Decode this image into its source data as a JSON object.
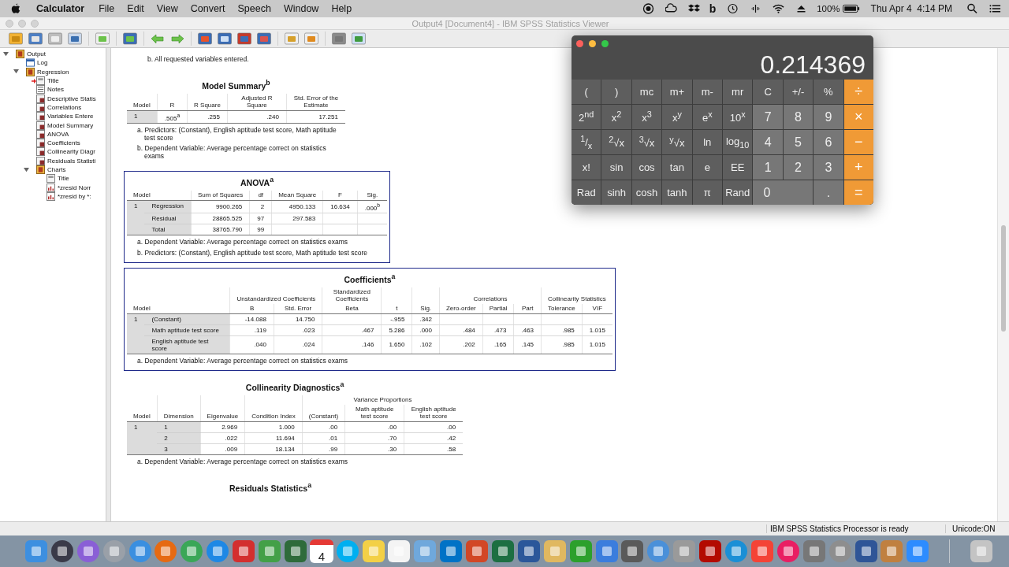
{
  "menu_bar": {
    "app": "Calculator",
    "menus": [
      "File",
      "Edit",
      "View",
      "Convert",
      "Speech",
      "Window",
      "Help"
    ],
    "status_letter": "b",
    "battery": "100%",
    "clock": "Thu Apr 4  4:14 PM"
  },
  "window": {
    "title": "Output4 [Document4] - IBM SPSS Statistics Viewer"
  },
  "navigator": [
    {
      "label": "Output",
      "kind": "book",
      "expanded": true,
      "current": false,
      "children": [
        {
          "label": "Log",
          "kind": "log",
          "current": false
        },
        {
          "label": "Regression",
          "kind": "book",
          "expanded": true,
          "current": false,
          "children": [
            {
              "label": "Title",
              "kind": "title",
              "current": true
            },
            {
              "label": "Notes",
              "kind": "notes",
              "current": false
            },
            {
              "label": "Descriptive Statis",
              "kind": "table",
              "current": false
            },
            {
              "label": "Correlations",
              "kind": "table",
              "current": false
            },
            {
              "label": "Variables Entere",
              "kind": "table",
              "current": false
            },
            {
              "label": "Model Summary",
              "kind": "table",
              "current": false
            },
            {
              "label": "ANOVA",
              "kind": "table",
              "current": false
            },
            {
              "label": "Coefficients",
              "kind": "table",
              "current": false
            },
            {
              "label": "Collinearity Diagr",
              "kind": "table",
              "current": false
            },
            {
              "label": "Residuals Statisti",
              "kind": "table",
              "current": false
            },
            {
              "label": "Charts",
              "kind": "book",
              "expanded": true,
              "current": false,
              "children": [
                {
                  "label": "Title",
                  "kind": "title",
                  "current": false
                },
                {
                  "label": "*zresid Norr",
                  "kind": "chart",
                  "current": false
                },
                {
                  "label": "*zresid by *:",
                  "kind": "chart",
                  "current": false
                }
              ]
            }
          ]
        }
      ]
    }
  ],
  "viewer": {
    "leading_note": "b. All requested variables entered.",
    "tables": [
      {
        "title": "Model Summary$^{b}$",
        "selected": false,
        "header_rows": [
          [
            {
              "text": "Model"
            },
            {
              "text": "R"
            },
            {
              "text": "R Square"
            },
            {
              "text": "Adjusted R Square"
            },
            {
              "text": "Std. Error of the Estimate"
            }
          ]
        ],
        "rows": [
          {
            "model": "1",
            "values": {
              "r": ".505$^{a}$",
              "r_square": ".255",
              "adjusted_r_square": ".240",
              "std_error": "17.251"
            }
          }
        ],
        "footnotes": [
          "a. Predictors: (Constant), English aptitude test score, Math aptitude test score",
          "b. Dependent Variable: Average percentage correct on statistics exams"
        ]
      },
      {
        "title": "ANOVA$^{a}$",
        "selected": true,
        "header_rows": [
          [
            {
              "text": "Model"
            },
            {
              "text": "Sum of Squares"
            },
            {
              "text": "df"
            },
            {
              "text": "Mean Square"
            },
            {
              "text": "F"
            },
            {
              "text": "Sig."
            }
          ]
        ],
        "rows": [
          {
            "model": "1",
            "label": "Regression",
            "values": {
              "sum_of_squares": "9900.265",
              "df": "2",
              "mean_square": "4950.133",
              "f": "16.634",
              "sig": ".000$^{b}$"
            }
          },
          {
            "label": "Residual",
            "values": {
              "sum_of_squares": "28865.525",
              "df": "97",
              "mean_square": "297.583"
            }
          },
          {
            "label": "Total",
            "values": {
              "sum_of_squares": "38765.790",
              "df": "99"
            }
          }
        ],
        "footnotes": [
          "a. Dependent Variable: Average percentage correct on statistics exams",
          "b. Predictors: (Constant), English aptitude test score, Math aptitude test score"
        ]
      },
      {
        "title": "Coefficients$^{a}$",
        "selected": true,
        "header_rows": [
          [
            {
              "text": "Model"
            },
            {
              "text": "Unstandardized Coefficients"
            },
            {
              "text": "Standardized Coefficients"
            },
            {
              "text": "t"
            },
            {
              "text": "Sig."
            },
            {
              "text": "Correlations"
            },
            {
              "text": "Collinearity Statistics"
            }
          ],
          [
            {
              "text": "B"
            },
            {
              "text": "Std. Error"
            },
            {
              "text": "Beta"
            },
            {
              "text": "Zero-order"
            },
            {
              "text": "Partial"
            },
            {
              "text": "Part"
            },
            {
              "text": "Tolerance"
            },
            {
              "text": "VIF"
            }
          ]
        ],
        "rows": [
          {
            "model": "1",
            "label": "(Constant)",
            "values": {
              "b": "-14.088",
              "std_error": "14.750",
              "t": "-.955",
              "sig": ".342"
            }
          },
          {
            "label": "Math aptitude test score",
            "values": {
              "b": ".119",
              "std_error": ".023",
              "beta": ".467",
              "t": "5.286",
              "sig": ".000",
              "zero_order": ".484",
              "partial": ".473",
              "part": ".463",
              "tolerance": ".985",
              "vif": "1.015"
            }
          },
          {
            "label": "English aptitude test score",
            "values": {
              "b": ".040",
              "std_error": ".024",
              "beta": ".146",
              "t": "1.650",
              "sig": ".102",
              "zero_order": ".202",
              "partial": ".165",
              "part": ".145",
              "tolerance": ".985",
              "vif": "1.015"
            }
          }
        ],
        "footnotes": [
          "a. Dependent Variable: Average percentage correct on statistics exams"
        ]
      },
      {
        "title": "Collinearity Diagnostics$^{a}$",
        "selected": false,
        "header_rows": [
          [
            {
              "text": "Model"
            },
            {
              "text": "Dimension"
            },
            {
              "text": "Eigenvalue"
            },
            {
              "text": "Condition Index"
            },
            {
              "text": "Variance Proportions"
            }
          ],
          [
            {
              "text": "(Constant)"
            },
            {
              "text": "Math aptitude test score"
            },
            {
              "text": "English aptitude test score"
            }
          ]
        ],
        "rows": [
          {
            "model": "1",
            "label": "1",
            "values": {
              "eigenvalue": "2.969",
              "condition_index": "1.000",
              "constant": ".00",
              "math": ".00",
              "english": ".00"
            }
          },
          {
            "label": "2",
            "values": {
              "eigenvalue": ".022",
              "condition_index": "11.694",
              "constant": ".01",
              "math": ".70",
              "english": ".42"
            }
          },
          {
            "label": "3",
            "values": {
              "eigenvalue": ".009",
              "condition_index": "18.134",
              "constant": ".99",
              "math": ".30",
              "english": ".58"
            }
          }
        ],
        "footnotes": [
          "a. Dependent Variable: Average percentage correct on statistics exams"
        ]
      }
    ],
    "trailing_title": "Residuals Statistics$^{a}$"
  },
  "status_bar": {
    "message": "IBM SPSS Statistics Processor is ready",
    "encoding": "Unicode:ON"
  },
  "dock": {
    "calendar_day": "4"
  },
  "calculator": {
    "display": "0.214369",
    "keys": [
      {
        "label": "(",
        "kind": "fn"
      },
      {
        "label": ")",
        "kind": "fn"
      },
      {
        "label": "mc",
        "kind": "fn"
      },
      {
        "label": "m+",
        "kind": "fn"
      },
      {
        "label": "m-",
        "kind": "fn"
      },
      {
        "label": "mr",
        "kind": "fn"
      },
      {
        "label": "C",
        "kind": "fn"
      },
      {
        "label": "+/-",
        "kind": "fn"
      },
      {
        "label": "%",
        "kind": "fn"
      },
      {
        "label": "÷",
        "kind": "op"
      },
      {
        "label": "2$^{nd}$",
        "kind": "fn"
      },
      {
        "label": "x$^{2}$",
        "kind": "fn"
      },
      {
        "label": "x$^{3}$",
        "kind": "fn"
      },
      {
        "label": "x$^{y}$",
        "kind": "fn"
      },
      {
        "label": "e$^{x}$",
        "kind": "fn"
      },
      {
        "label": "10$^{x}$",
        "kind": "fn"
      },
      {
        "label": "7",
        "kind": "digit"
      },
      {
        "label": "8",
        "kind": "digit"
      },
      {
        "label": "9",
        "kind": "digit"
      },
      {
        "label": "×",
        "kind": "op"
      },
      {
        "label": "$^{1}$/$_{x}$",
        "kind": "fn"
      },
      {
        "label": "$^{2}$√x",
        "kind": "fn"
      },
      {
        "label": "$^{3}$√x",
        "kind": "fn"
      },
      {
        "label": "$^{y}$√x",
        "kind": "fn"
      },
      {
        "label": "ln",
        "kind": "fn"
      },
      {
        "label": "log$_{10}$",
        "kind": "fn"
      },
      {
        "label": "4",
        "kind": "digit"
      },
      {
        "label": "5",
        "kind": "digit"
      },
      {
        "label": "6",
        "kind": "digit"
      },
      {
        "label": "−",
        "kind": "op"
      },
      {
        "label": "x!",
        "kind": "fn"
      },
      {
        "label": "sin",
        "kind": "fn"
      },
      {
        "label": "cos",
        "kind": "fn"
      },
      {
        "label": "tan",
        "kind": "fn"
      },
      {
        "label": "e",
        "kind": "fn"
      },
      {
        "label": "EE",
        "kind": "fn"
      },
      {
        "label": "1",
        "kind": "digit"
      },
      {
        "label": "2",
        "kind": "digit"
      },
      {
        "label": "3",
        "kind": "digit"
      },
      {
        "label": "+",
        "kind": "op"
      },
      {
        "label": "Rad",
        "kind": "fn"
      },
      {
        "label": "sinh",
        "kind": "fn"
      },
      {
        "label": "cosh",
        "kind": "fn"
      },
      {
        "label": "tanh",
        "kind": "fn"
      },
      {
        "label": "π",
        "kind": "fn"
      },
      {
        "label": "Rand",
        "kind": "fn"
      },
      {
        "label": "0",
        "kind": "wide"
      },
      {
        "label": ".",
        "kind": "digit"
      },
      {
        "label": "=",
        "kind": "op"
      }
    ]
  }
}
